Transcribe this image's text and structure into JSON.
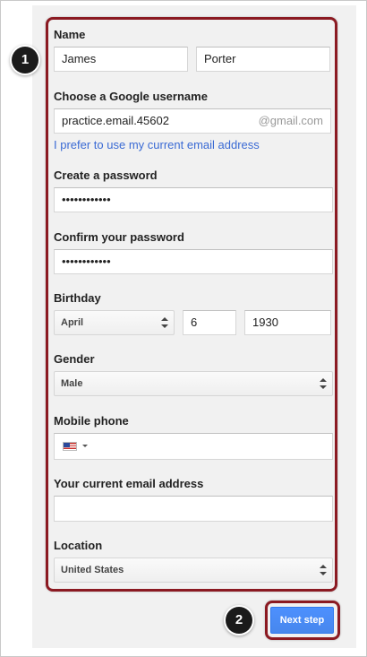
{
  "form": {
    "name_label": "Name",
    "first_name": "James",
    "last_name": "Porter",
    "username_label": "Choose a Google username",
    "username_value": "practice.email.45602",
    "username_suffix": "@gmail.com",
    "use_current_email_link": "I prefer to use my current email address",
    "password_label": "Create a password",
    "password_value": "••••••••••••",
    "confirm_password_label": "Confirm your password",
    "confirm_password_value": "••••••••••••",
    "birthday_label": "Birthday",
    "birthday_month": "April",
    "birthday_day": "6",
    "birthday_year": "1930",
    "gender_label": "Gender",
    "gender_value": "Male",
    "mobile_label": "Mobile phone",
    "mobile_value": "",
    "current_email_label": "Your current email address",
    "current_email_value": "",
    "location_label": "Location",
    "location_value": "United States"
  },
  "callouts": {
    "step_1": "1",
    "step_2": "2"
  },
  "actions": {
    "next_step_label": "Next step"
  },
  "icons": {
    "select_arrows": "updown-arrows-icon",
    "country_flag": "us-flag-icon"
  },
  "colors": {
    "highlight": "#8b1a22",
    "primary_button": "#4d90fe",
    "link": "#3a6ad4",
    "panel_background": "#f1f1f1"
  }
}
